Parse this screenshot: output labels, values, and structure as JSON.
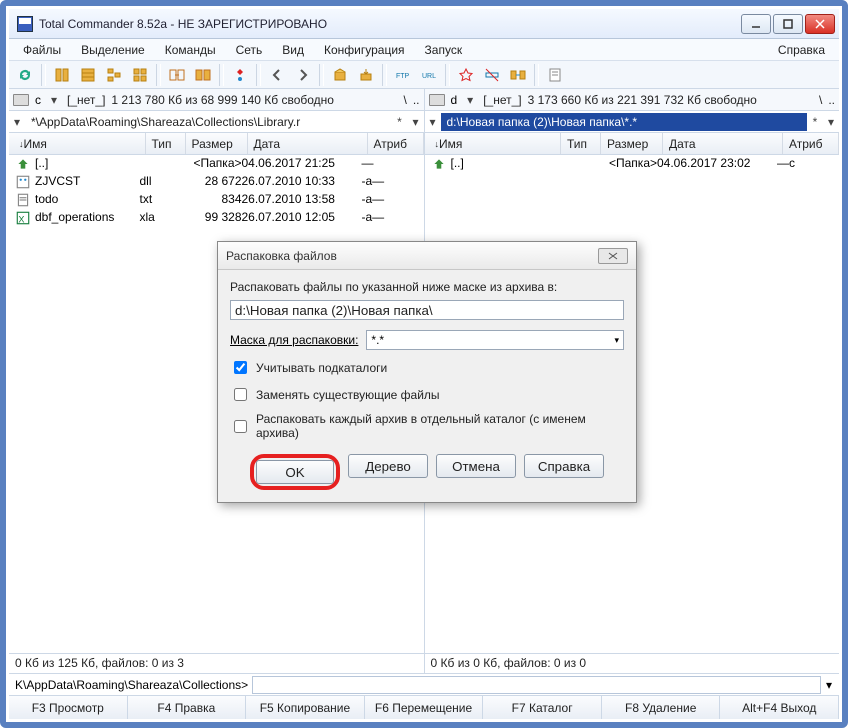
{
  "title": "Total Commander 8.52a - НЕ ЗАРЕГИСТРИРОВАНО",
  "menu": {
    "files": "Файлы",
    "select": "Выделение",
    "commands": "Команды",
    "net": "Сеть",
    "view": "Вид",
    "config": "Конфигурация",
    "start": "Запуск",
    "help": "Справка"
  },
  "drive": {
    "left": {
      "letter": "c",
      "none": "[_нет_]",
      "space": "1 213 780 Кб из 68 999 140 Кб свободно",
      "dots": ".."
    },
    "right": {
      "letter": "d",
      "none": "[_нет_]",
      "space": "3 173 660 Кб из 221 391 732 Кб свободно",
      "dots": ".."
    }
  },
  "path": {
    "left": "*\\AppData\\Roaming\\Shareaza\\Collections\\Library.r",
    "right": "d:\\Новая папка (2)\\Новая папка\\*.*"
  },
  "cols": {
    "name": "Имя",
    "ext": "Тип",
    "size": "Размер",
    "date": "Дата",
    "attr": "Атриб"
  },
  "left_rows": [
    {
      "icon": "up",
      "name": "[..]",
      "ext": "",
      "size": "<Папка>",
      "date": "04.06.2017 21:25",
      "attr": "—"
    },
    {
      "icon": "dll",
      "name": "ZJVCST",
      "ext": "dll",
      "size": "28 672",
      "date": "26.07.2010 10:33",
      "attr": "-a—"
    },
    {
      "icon": "txt",
      "name": "todo",
      "ext": "txt",
      "size": "834",
      "date": "26.07.2010 13:58",
      "attr": "-a—"
    },
    {
      "icon": "xla",
      "name": "dbf_operations",
      "ext": "xla",
      "size": "99 328",
      "date": "26.07.2010 12:05",
      "attr": "-a—"
    }
  ],
  "right_rows": [
    {
      "icon": "up",
      "name": "[..]",
      "ext": "",
      "size": "<Папка>",
      "date": "04.06.2017 23:02",
      "attr": "—c"
    }
  ],
  "status": {
    "left": "0 Кб из 125 Кб, файлов: 0 из 3",
    "right": "0 Кб из 0 Кб, файлов: 0 из 0"
  },
  "cmdline": {
    "prompt": "K\\AppData\\Roaming\\Shareaza\\Collections>"
  },
  "fkeys": {
    "f3": "F3 Просмотр",
    "f4": "F4 Правка",
    "f5": "F5 Копирование",
    "f6": "F6 Перемещение",
    "f7": "F7 Каталог",
    "f8": "F8 Удаление",
    "altf4": "Alt+F4 Выход"
  },
  "dialog": {
    "title": "Распаковка файлов",
    "lbl": "Распаковать файлы по указанной ниже маске из архива в:",
    "path": "d:\\Новая папка (2)\\Новая папка\\",
    "mask_lbl": "Маска для распаковки:",
    "mask_val": "*.*",
    "chk1": "Учитывать подкаталоги",
    "chk2": "Заменять существующие файлы",
    "chk3": "Распаковать каждый архив в отдельный каталог (с именем архива)",
    "ok": "OK",
    "tree": "Дерево",
    "cancel": "Отмена",
    "help": "Справка"
  }
}
